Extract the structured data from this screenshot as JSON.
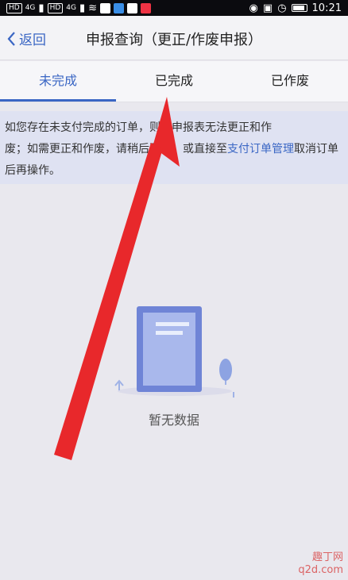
{
  "statusbar": {
    "left_chips": [
      "HD",
      "4G",
      "HD",
      "4G"
    ],
    "time": "10:21"
  },
  "navbar": {
    "back_label": "返回",
    "title": "申报查询（更正/作废申报）"
  },
  "tabs": [
    {
      "label": "未完成",
      "active": true
    },
    {
      "label": "已完成",
      "active": false
    },
    {
      "label": "已作废",
      "active": false
    }
  ],
  "notice": {
    "line1": "如您存在未支付完成的订单，则该申报表无法更正和作",
    "line2": "废；如需更正和作废，请稍后再试，或直接至",
    "link": "支付订单管理",
    "line3": "取消订单后再操作。"
  },
  "empty_state": {
    "text": "暂无数据"
  },
  "watermark": {
    "line1": "趣丁网",
    "line2": "q2d.com"
  },
  "colors": {
    "accent": "#3a66c4",
    "arrow": "#e8282b",
    "notice_bg": "#dfe2f2"
  }
}
